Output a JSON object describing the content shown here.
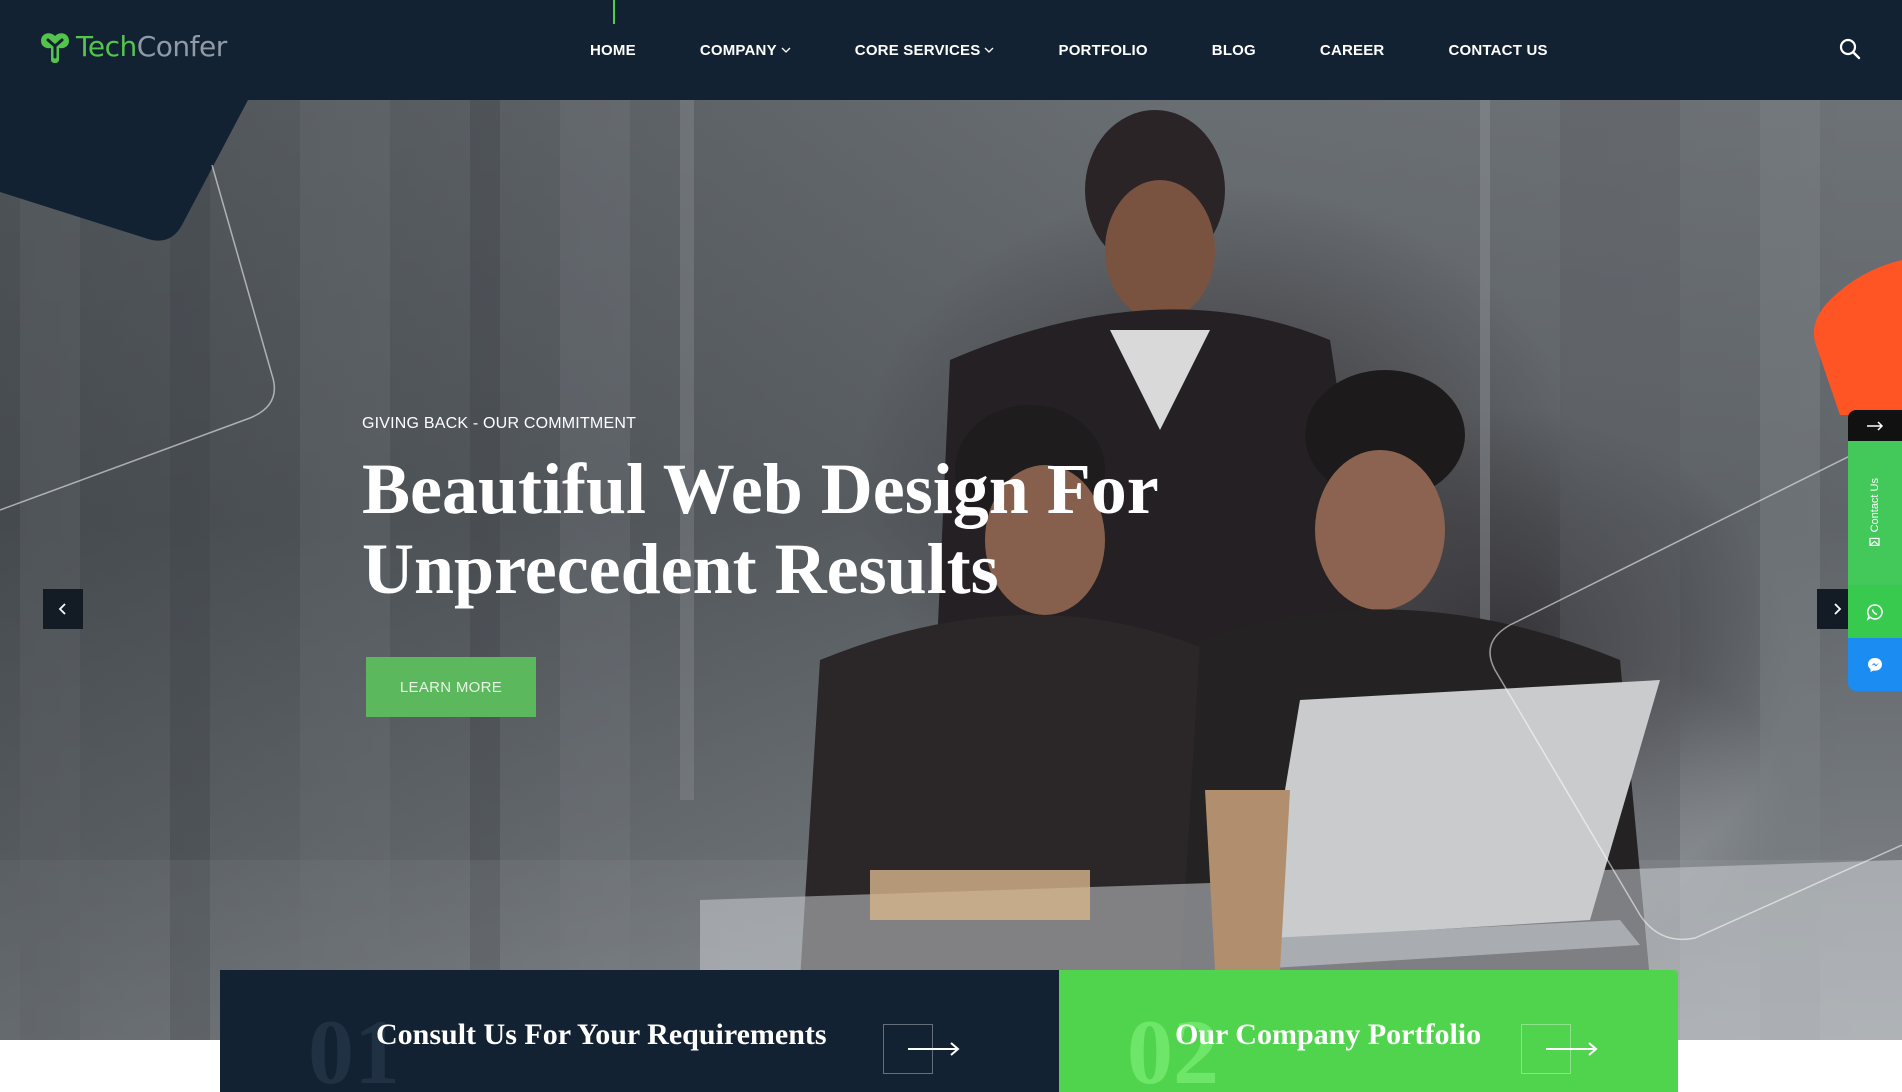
{
  "brand": {
    "name_part1": "Tech",
    "name_part2": "Confer",
    "primary": "#53c44c",
    "header_bg": "#132232"
  },
  "nav": {
    "items": [
      {
        "label": "HOME",
        "dropdown": false,
        "active": true
      },
      {
        "label": "COMPANY",
        "dropdown": true,
        "active": false
      },
      {
        "label": "CORE SERVICES",
        "dropdown": true,
        "active": false
      },
      {
        "label": "PORTFOLIO",
        "dropdown": false,
        "active": false
      },
      {
        "label": "BLOG",
        "dropdown": false,
        "active": false
      },
      {
        "label": "CAREER",
        "dropdown": false,
        "active": false
      },
      {
        "label": "CONTACT US",
        "dropdown": false,
        "active": false
      }
    ],
    "search_icon": "search-icon"
  },
  "hero": {
    "subtitle": "GIVING BACK - OUR COMMITMENT",
    "headline_line1": "Beautiful Web Design For",
    "headline_line2": "Unprecedent Results",
    "cta_label": "LEARN MORE",
    "cta_color": "#5cb85c",
    "prev_icon": "chevron-left-icon",
    "next_icon": "chevron-right-icon"
  },
  "side_widget": {
    "contact_label": "Contact Us",
    "arrow_icon": "arrow-right-icon",
    "whatsapp_icon": "whatsapp-icon",
    "messenger_icon": "messenger-icon",
    "colors": {
      "contact": "#43c85a",
      "whatsapp": "#38c94f",
      "messenger": "#1a8cf2"
    }
  },
  "cards": [
    {
      "number": "01",
      "title": "Consult Us For Your Requirements",
      "bg": "#132232"
    },
    {
      "number": "02",
      "title": "Our Company Portfolio",
      "bg": "#51d44d"
    }
  ]
}
